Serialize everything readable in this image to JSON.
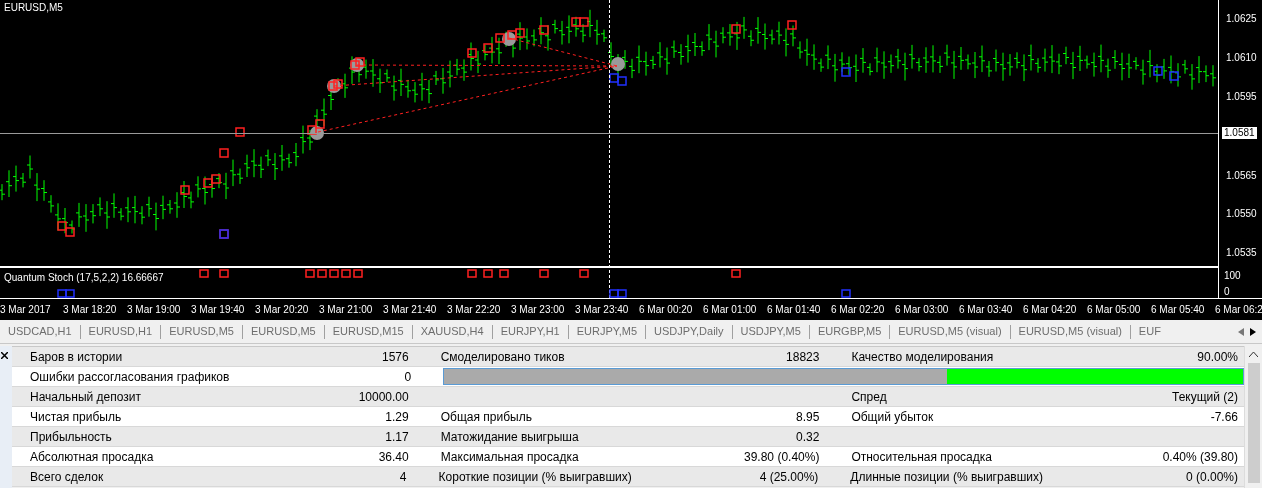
{
  "chart": {
    "title": "EURUSD,M5",
    "price_labels": [
      "1.0625",
      "1.0610",
      "1.0595",
      "1.0565",
      "1.0550",
      "1.0535"
    ],
    "crosshair_price": "1.0581",
    "indicator": {
      "title": "Quantum Stoch (17,5,2,2) 16.66667",
      "scale": [
        "100",
        "0"
      ]
    },
    "time_labels": [
      "3 Mar 2017",
      "3 Mar 18:20",
      "3 Mar 19:00",
      "3 Mar 19:40",
      "3 Mar 20:20",
      "3 Mar 21:00",
      "3 Mar 21:40",
      "3 Mar 22:20",
      "3 Mar 23:00",
      "3 Mar 23:40",
      "6 Mar 00:20",
      "6 Mar 01:00",
      "6 Mar 01:40",
      "6 Mar 02:20",
      "6 Mar 03:00",
      "6 Mar 03:40",
      "6 Mar 04:20",
      "6 Mar 05:00",
      "6 Mar 05:40",
      "6 Mar 06:2"
    ]
  },
  "tabs": [
    "USDCAD,H1",
    "EURUSD,H1",
    "EURUSD,M5",
    "EURUSD,M5",
    "EURUSD,M15",
    "XAUUSD,H4",
    "EURJPY,H1",
    "EURJPY,M5",
    "USDJPY,Daily",
    "USDJPY,M5",
    "EURGBP,M5",
    "EURUSD,M5 (visual)",
    "EURUSD,M5 (visual)",
    "EUF"
  ],
  "report": [
    {
      "kind": "text",
      "cells": [
        "Баров в истории",
        "1576",
        "Смоделировано тиков",
        "18823",
        "Качество моделирования",
        "90.00%"
      ]
    },
    {
      "kind": "bar",
      "cells": [
        "Ошибки рассогласования графиков",
        "0"
      ],
      "level": 0.37
    },
    {
      "kind": "text",
      "cells": [
        "Начальный депозит",
        "10000.00",
        "",
        "",
        "Спред",
        "Текущий (2)"
      ]
    },
    {
      "kind": "text",
      "cells": [
        "Чистая прибыль",
        "1.29",
        "Общая прибыль",
        "8.95",
        "Общий убыток",
        "-7.66"
      ]
    },
    {
      "kind": "text",
      "cells": [
        "Прибыльность",
        "1.17",
        "Матожидание выигрыша",
        "0.32",
        "",
        ""
      ]
    },
    {
      "kind": "text",
      "cells": [
        "Абсолютная просадка",
        "36.40",
        "Максимальная просадка",
        "39.80 (0.40%)",
        "Относительная просадка",
        "0.40% (39.80)"
      ]
    },
    {
      "kind": "text",
      "cells": [
        "Всего сделок",
        "4",
        "Короткие позиции (% выигравших)",
        "4 (25.00%)",
        "Длинные позиции (% выигравших)",
        "0 (0.00%)"
      ]
    }
  ]
}
